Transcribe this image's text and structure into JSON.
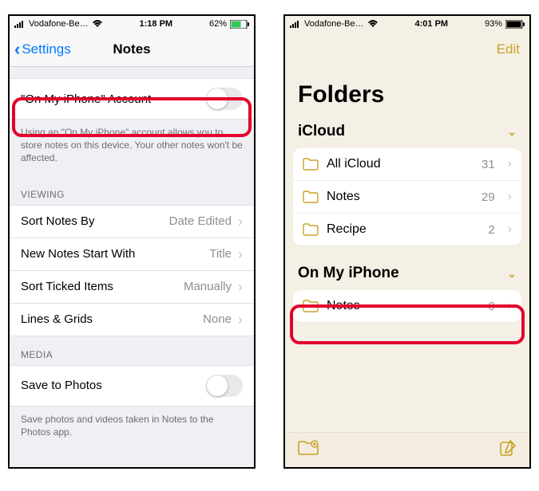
{
  "left": {
    "status": {
      "carrier": "Vodafone-Be…",
      "time": "1:18 PM",
      "battery": "62%"
    },
    "nav": {
      "back_label": "Settings",
      "title": "Notes"
    },
    "account_toggle": {
      "label": "\"On My iPhone\" Account",
      "on": false
    },
    "account_footer": "Using an \"On My iPhone\" account allows you to store notes on this device. Your other notes won't be affected.",
    "viewing": {
      "header": "VIEWING",
      "rows": [
        {
          "label": "Sort Notes By",
          "value": "Date Edited"
        },
        {
          "label": "New Notes Start With",
          "value": "Title"
        },
        {
          "label": "Sort Ticked Items",
          "value": "Manually"
        },
        {
          "label": "Lines & Grids",
          "value": "None"
        }
      ]
    },
    "media": {
      "header": "MEDIA",
      "save_to_photos_label": "Save to Photos",
      "save_to_photos_on": false,
      "footer": "Save photos and videos taken in Notes to the Photos app."
    }
  },
  "right": {
    "status": {
      "carrier": "Vodafone-Be…",
      "time": "4:01 PM",
      "battery": "93%"
    },
    "nav": {
      "edit_label": "Edit"
    },
    "title": "Folders",
    "sections": [
      {
        "name": "iCloud",
        "folders": [
          {
            "name": "All iCloud",
            "count": 31
          },
          {
            "name": "Notes",
            "count": 29
          },
          {
            "name": "Recipe",
            "count": 2
          }
        ]
      },
      {
        "name": "On My iPhone",
        "folders": [
          {
            "name": "Notes",
            "count": 0
          }
        ]
      }
    ]
  },
  "colors": {
    "accent_blue": "#007aff",
    "accent_gold": "#c9a227",
    "highlight_red": "#e4002b"
  }
}
